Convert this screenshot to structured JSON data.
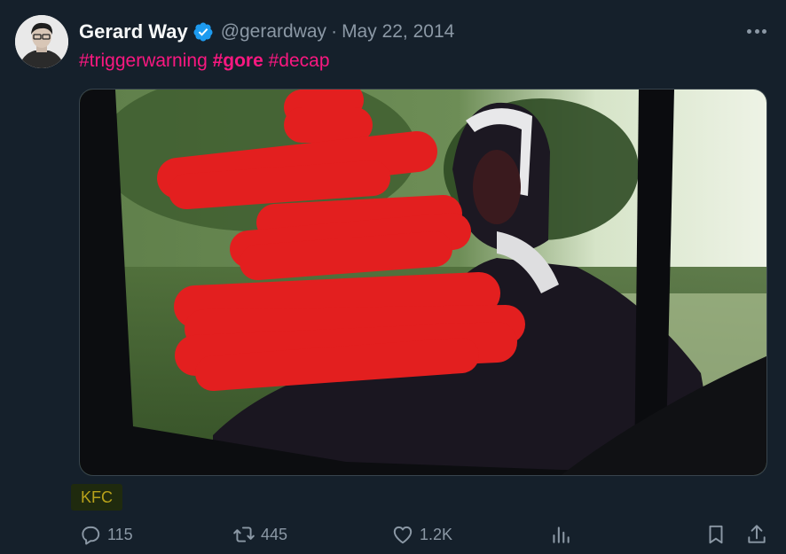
{
  "tweet": {
    "display_name": "Gerard Way",
    "handle": "@gerardway",
    "separator": "·",
    "date": "May 22, 2014",
    "verified": true,
    "hashtags": [
      {
        "text": "#triggerwarning",
        "bold": false
      },
      {
        "text": "#gore",
        "bold": true
      },
      {
        "text": "#decap",
        "bold": false
      }
    ],
    "media_badge": "KFC"
  },
  "actions": {
    "replies": "115",
    "retweets": "445",
    "likes": "1.2K"
  },
  "icons": {
    "verified": "verified-badge-icon",
    "more": "more-options-icon",
    "reply": "reply-icon",
    "retweet": "retweet-icon",
    "like": "heart-icon",
    "views": "analytics-icon",
    "bookmark": "bookmark-icon",
    "share": "share-icon"
  },
  "colors": {
    "background": "#15202b",
    "hashtag": "#f91880",
    "muted": "#8b98a5",
    "verified": "#1d9bf0",
    "censor": "#e31f1f"
  }
}
